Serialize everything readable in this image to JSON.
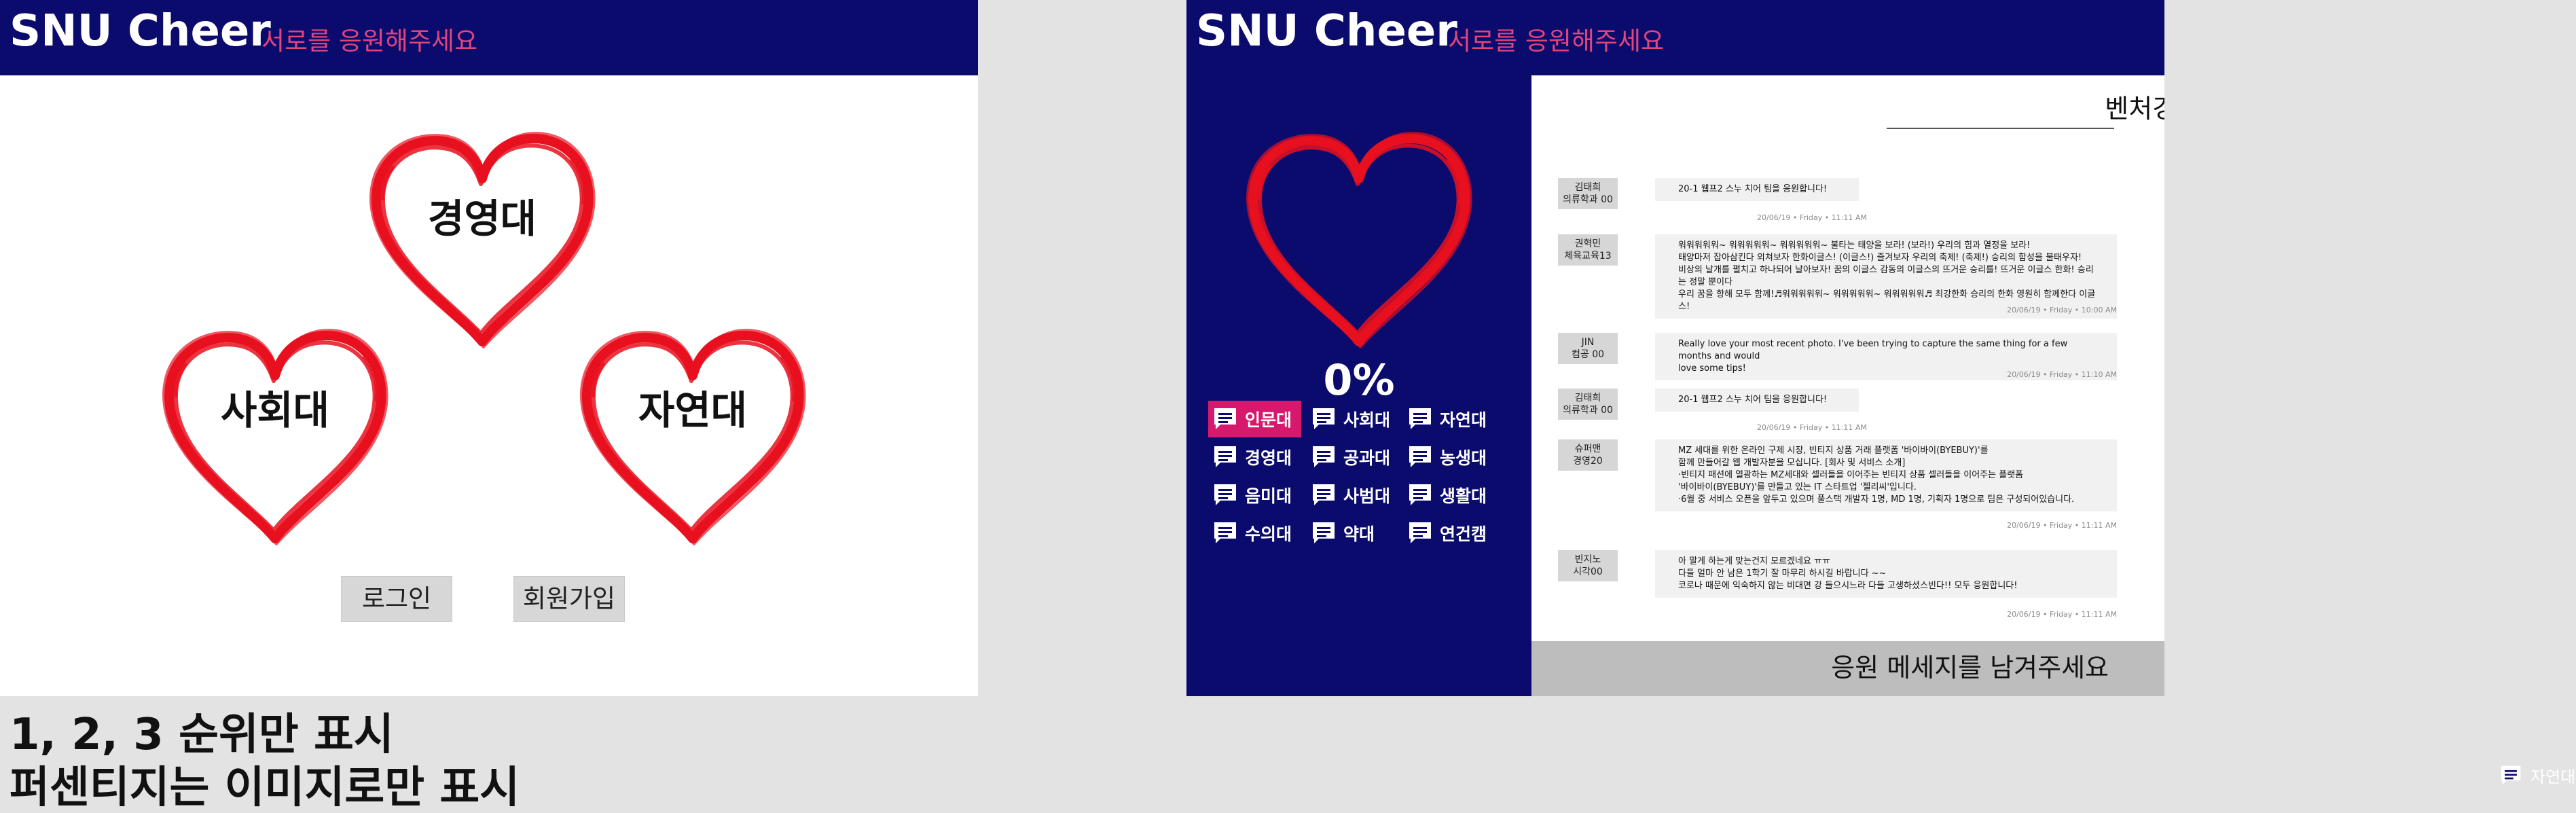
{
  "brand": {
    "title": "SNU Cheer",
    "tagline": "서로를 응원해주세요"
  },
  "colors": {
    "header_bg": "#0b0b6e",
    "accent_pink": "#e0457b",
    "heart_red": "#e8101e",
    "active_category": "#d6196d"
  },
  "home": {
    "ranking": [
      "경영대",
      "사회대",
      "자연대"
    ],
    "login_label": "로그인",
    "signup_label": "회원가입"
  },
  "room": {
    "progress_percent_label": "0%",
    "progress_fraction": 0,
    "categories": [
      {
        "label": "인문대",
        "active": true,
        "icon": "chat-bubble-icon"
      },
      {
        "label": "사회대",
        "active": false,
        "icon": "chat-bubble-icon"
      },
      {
        "label": "자연대",
        "active": false,
        "icon": "chat-bubble-icon"
      },
      {
        "label": "경영대",
        "active": false,
        "icon": "chat-bubble-icon"
      },
      {
        "label": "공과대",
        "active": false,
        "icon": "chat-bubble-icon"
      },
      {
        "label": "농생대",
        "active": false,
        "icon": "chat-bubble-icon"
      },
      {
        "label": "음미대",
        "active": false,
        "icon": "chat-bubble-icon"
      },
      {
        "label": "사범대",
        "active": false,
        "icon": "chat-bubble-icon"
      },
      {
        "label": "생활대",
        "active": false,
        "icon": "chat-bubble-icon"
      },
      {
        "label": "수의대",
        "active": false,
        "icon": "chat-bubble-icon"
      },
      {
        "label": "약대",
        "active": false,
        "icon": "chat-bubble-icon"
      },
      {
        "label": "연건캠",
        "active": false,
        "icon": "chat-bubble-icon"
      }
    ],
    "title": "벤처경영학과 응원방",
    "messages": [
      {
        "author": [
          "김태희",
          "의류학과 00"
        ],
        "lines": [
          "20-1 웹프2 스누 치어 팀을 응원합니다!"
        ],
        "time": "20/06/19 • Friday • 11:11 AM"
      },
      {
        "author": [
          "권혁민",
          "체육교육13"
        ],
        "lines": [
          "워워워워워~ 워워워워워~ 워워워워워~ 불타는 태양을 보라! (보라!) 우리의 힘과 열정을 보라!",
          "태양마저 잡아삼킨다 외쳐보자 한화이글스! (이글스!) 즐겨보자 우리의 축제! (축제!) 승리의 함성을 불태우자!",
          "비상의 날개를 펼치고 하나되어 날아보자! 꿈의 이글스 감동의 이글스의 뜨거운 승리를! 뜨거운 이글스 한화! 승리는 정말 뿐이다",
          "우리 꿈을 향해 모두 함께!♬워워워워워~ 워워워워워~ 워워워워워♬ 최강한화 승리의 한화 영원히 함께한다 이글스!"
        ],
        "time": "20/06/19 • Friday • 10:00 AM"
      },
      {
        "author": [
          "JIN",
          "컴공 00"
        ],
        "lines": [
          "Really love your most recent photo. I've been trying to capture the same thing for a few months and would",
          "love some tips!"
        ],
        "time": "20/06/19 • Friday • 11:10 AM"
      },
      {
        "author": [
          "김태희",
          "의류학과 00"
        ],
        "lines": [
          "20-1 웹프2 스누 치어 팀을 응원합니다!"
        ],
        "time": "20/06/19 • Friday • 11:11 AM"
      },
      {
        "author": [
          "슈퍼맨",
          "경영20"
        ],
        "lines": [
          "MZ 세대를 위한 온라인 구제 시장, 빈티지 상품 거래 플랫폼 '바이바이(BYEBUY)'를",
          "함께 만들어갈 웹 개발자분을 모십니다. [회사 및 서비스 소개]",
          "·빈티지 패션에 열광하는 MZ세대와 셀러들을 이어주는 빈티지 상품 셀러들을 이어주는 플랫폼",
          "'바이바이(BYEBUY)'를 만들고 있는 IT 스타트업 '젤리씨'입니다.",
          "·6월 중 서비스 오픈을 앞두고 있으며 풀스택 개발자 1명, MD 1명, 기획자 1명으로 팀은 구성되어있습니다."
        ],
        "time": "20/06/19 • Friday • 11:11 AM"
      },
      {
        "author": [
          "빈지노",
          "시각00"
        ],
        "lines": [
          "아 말게 하는게 맞는건지 모르겠네요 ㅠㅠ",
          "다들 얼마 안 남은 1학기 잘 마무리 하시길 바랍니다 ~~",
          "코로나 때문에 익숙하지 않는 비대면 강 들으시느라 다들 고생하셨스빈다!! 모두 응원합니다!"
        ],
        "time": "20/06/19 • Friday • 11:11 AM"
      }
    ],
    "compose_placeholder": "응원 메세지를 남겨주세요"
  },
  "notes": [
    "1, 2, 3 순위만 표시",
    "퍼센티지는 이미지로만 표시"
  ],
  "ghost_item": {
    "label": "자연대",
    "icon": "chat-bubble-icon"
  }
}
